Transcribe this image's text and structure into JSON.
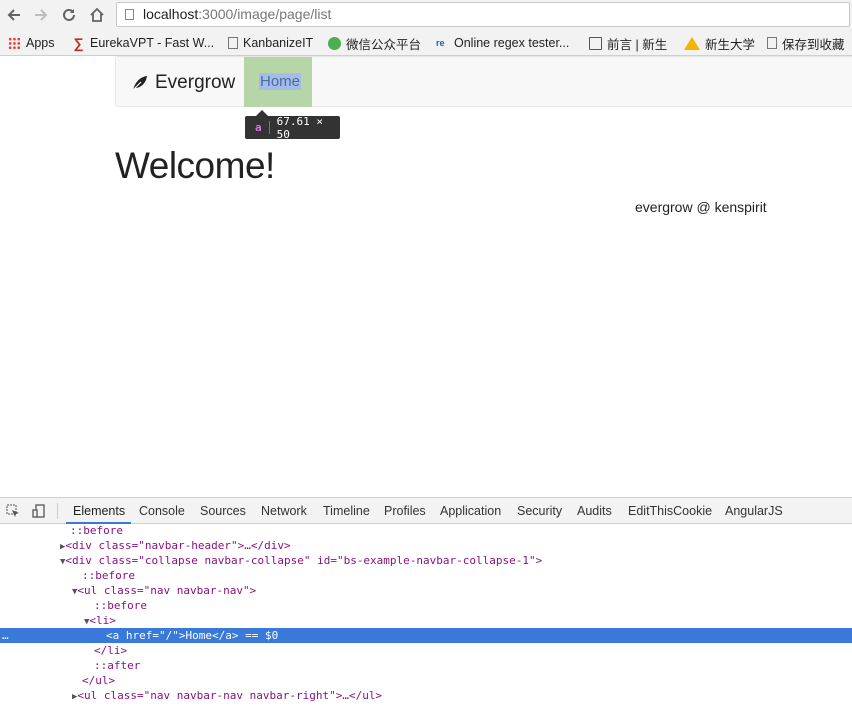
{
  "browser": {
    "url_host": "localhost",
    "url_path": ":3000/image/page/list"
  },
  "bookmarks": [
    {
      "label": "Apps",
      "icon": "apps-grid-icon"
    },
    {
      "label": "EurekaVPT - Fast W...",
      "icon": "sigma-icon"
    },
    {
      "label": "KanbanizeIT",
      "icon": "page-icon"
    },
    {
      "label": "微信公众平台",
      "icon": "wechat-icon"
    },
    {
      "label": "Online regex tester...",
      "icon": "regex-icon"
    },
    {
      "label": "前言 | 新生",
      "icon": "book-icon"
    },
    {
      "label": "新生大学",
      "icon": "triangle-logo-icon"
    },
    {
      "label": "保存到收藏",
      "icon": "page-icon"
    }
  ],
  "site": {
    "brand": "Evergrow",
    "nav_home": "Home",
    "heading": "Welcome!",
    "footer": "evergrow @ kenspirit"
  },
  "inspector_tooltip": {
    "tag": "a",
    "size": "67.61 × 50"
  },
  "devtools": {
    "tabs": [
      "Elements",
      "Console",
      "Sources",
      "Network",
      "Timeline",
      "Profiles",
      "Application",
      "Security",
      "Audits",
      "EditThisCookie",
      "AngularJS"
    ],
    "active_tab": "Elements",
    "dom_lines": [
      "::before",
      "<div class=\"navbar-header\">…</div>",
      "<div class=\"collapse navbar-collapse\" id=\"bs-example-navbar-collapse-1\">",
      "::before",
      "<ul class=\"nav navbar-nav\">",
      "::before",
      "<li>",
      "<a href=\"/\">Home</a> == $0",
      "</li>",
      "::after",
      "</ul>",
      "<ul class=\"nav navbar-nav navbar-right\">…</ul>"
    ]
  },
  "colors": {
    "highlight_green": "#b7d6a8",
    "selection_blue": "#3879d9"
  }
}
